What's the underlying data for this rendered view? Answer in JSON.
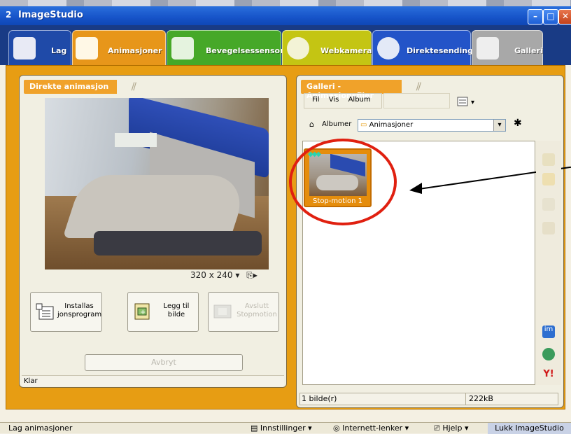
{
  "window": {
    "title": "ImageStudio",
    "app_number": "2"
  },
  "tabs": [
    {
      "label": "Lag",
      "color": "#1f4aa8"
    },
    {
      "label": "Animasjoner",
      "color": "#e7961a"
    },
    {
      "label": "Bevegelsessensor",
      "color": "#46a828"
    },
    {
      "label": "Webkamera",
      "color": "#c4c513"
    },
    {
      "label": "Direktesending",
      "color": "#2354c8"
    },
    {
      "label": "Galleri",
      "color": "#a8a8a8"
    }
  ],
  "left_panel": {
    "title": "Direkte animasjon",
    "resolution": "320 x 240",
    "buttons": [
      {
        "label": "Installas jonsprogram"
      },
      {
        "label": "Legg til bilde"
      },
      {
        "label": "Avslutt Stopmotion"
      }
    ],
    "stop_label": "Avbryt",
    "status": "Klar"
  },
  "right_panel": {
    "title": "Galleri - Animasjonsfiler",
    "menu": [
      "Fil",
      "Vis",
      "Album"
    ],
    "album_label": "Albumer",
    "album_value": "Animasjoner",
    "thumbnail_caption": "Stop-motion 1",
    "status_count": "1 bilde(r)",
    "status_size": "222kB"
  },
  "bottom_bar": {
    "left_text": "Lag animasjoner",
    "settings": "Innstillinger",
    "links": "Internett-lenker",
    "help": "Hjelp",
    "close": "Lukk ImageStudio"
  },
  "colors": {
    "accent_orange": "#e79d13",
    "annotation_red": "#e02010",
    "tabbar": "#193b85"
  }
}
